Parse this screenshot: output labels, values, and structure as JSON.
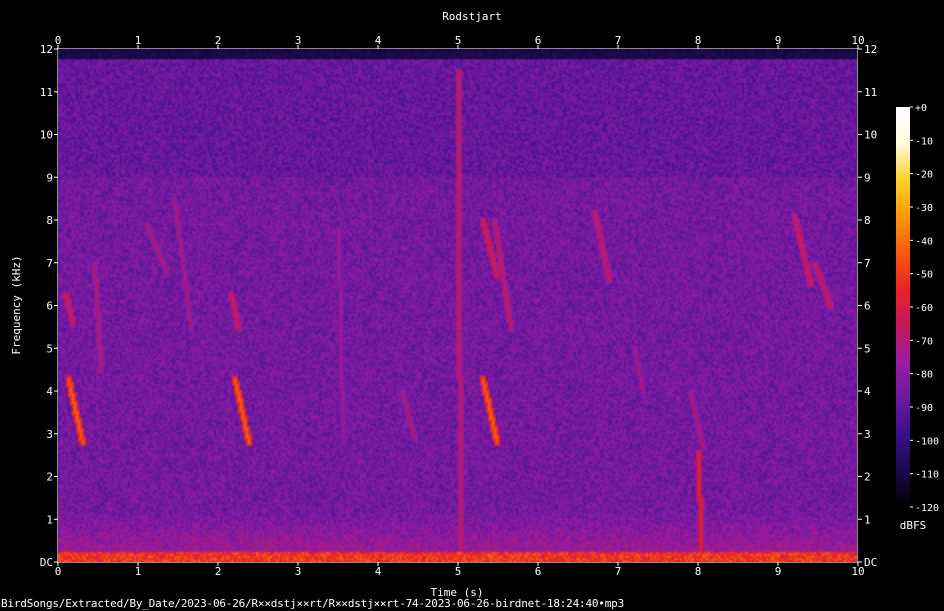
{
  "chart_data": {
    "type": "heatmap",
    "title": "Rodstjart",
    "xlabel": "Time (s)",
    "ylabel": "Frequency (kHz)",
    "x_ticks": [
      "0",
      "1",
      "2",
      "3",
      "4",
      "5",
      "6",
      "7",
      "8",
      "9",
      "10"
    ],
    "y_ticks": [
      "DC",
      "1",
      "2",
      "3",
      "4",
      "5",
      "6",
      "7",
      "8",
      "9",
      "10",
      "11",
      "12"
    ],
    "xlim": [
      0,
      10
    ],
    "ylim": [
      0,
      12
    ],
    "colorbar": {
      "label": "dBFS",
      "range": [
        -120,
        0
      ],
      "ticks": [
        "+0",
        "-10",
        "-20",
        "-30",
        "-40",
        "-50",
        "-60",
        "-70",
        "-80",
        "-90",
        "-100",
        "-110",
        "-120"
      ],
      "colors": [
        "#000000",
        "#1a0a4a",
        "#3a0f8a",
        "#6a1aa0",
        "#9a1c9e",
        "#c4185a",
        "#e8242a",
        "#f75a10",
        "#fb9a08",
        "#fcd22a",
        "#fffbe0",
        "#ffffff"
      ]
    },
    "noise_floor_dbfs": -85,
    "noise_ceiling_khz": 11.6,
    "calls": [
      {
        "t": 0.12,
        "f_start": 4.3,
        "f_end": 2.8,
        "dur": 0.18,
        "level": -45
      },
      {
        "t": 0.08,
        "f_start": 6.3,
        "f_end": 5.6,
        "dur": 0.1,
        "level": -65
      },
      {
        "t": 0.45,
        "f_start": 7.0,
        "f_end": 4.5,
        "dur": 0.08,
        "level": -70
      },
      {
        "t": 1.1,
        "f_start": 7.9,
        "f_end": 6.8,
        "dur": 0.25,
        "level": -72
      },
      {
        "t": 1.45,
        "f_start": 8.5,
        "f_end": 5.5,
        "dur": 0.2,
        "level": -72
      },
      {
        "t": 2.2,
        "f_start": 4.3,
        "f_end": 2.8,
        "dur": 0.18,
        "level": -45
      },
      {
        "t": 2.15,
        "f_start": 6.3,
        "f_end": 5.5,
        "dur": 0.1,
        "level": -65
      },
      {
        "t": 3.5,
        "f_end": 2.9,
        "f_start": 7.8,
        "dur": 0.05,
        "level": -75
      },
      {
        "t": 4.3,
        "f_start": 4.0,
        "f_end": 2.9,
        "dur": 0.15,
        "level": -72
      },
      {
        "t": 5.3,
        "f_start": 4.3,
        "f_end": 2.8,
        "dur": 0.18,
        "level": -45
      },
      {
        "t": 5.3,
        "f_start": 8.0,
        "f_end": 6.7,
        "dur": 0.18,
        "level": -62
      },
      {
        "t": 5.45,
        "f_start": 8.0,
        "f_end": 5.5,
        "dur": 0.2,
        "level": -66
      },
      {
        "t": 6.7,
        "f_start": 8.2,
        "f_end": 6.6,
        "dur": 0.18,
        "level": -66
      },
      {
        "t": 7.2,
        "f_start": 5.0,
        "f_end": 4.0,
        "dur": 0.1,
        "level": -74
      },
      {
        "t": 7.9,
        "f_start": 4.0,
        "f_end": 2.7,
        "dur": 0.15,
        "level": -72
      },
      {
        "t": 9.2,
        "f_start": 8.1,
        "f_end": 6.5,
        "dur": 0.2,
        "level": -64
      },
      {
        "t": 9.45,
        "f_start": 7.0,
        "f_end": 6.0,
        "dur": 0.2,
        "level": -66
      },
      {
        "t": 5.0,
        "f_start": 11.5,
        "f_end": 0.0,
        "dur": 0.02,
        "level": -62
      },
      {
        "t": 8.0,
        "f_start": 2.6,
        "f_end": 0.0,
        "dur": 0.03,
        "level": -58
      }
    ]
  },
  "caption": "BirdSongs/Extracted/By_Date/2023-06-26/R××dstj××rt/R××dstj××rt-74-2023-06-26-birdnet-18:24:40•mp3"
}
